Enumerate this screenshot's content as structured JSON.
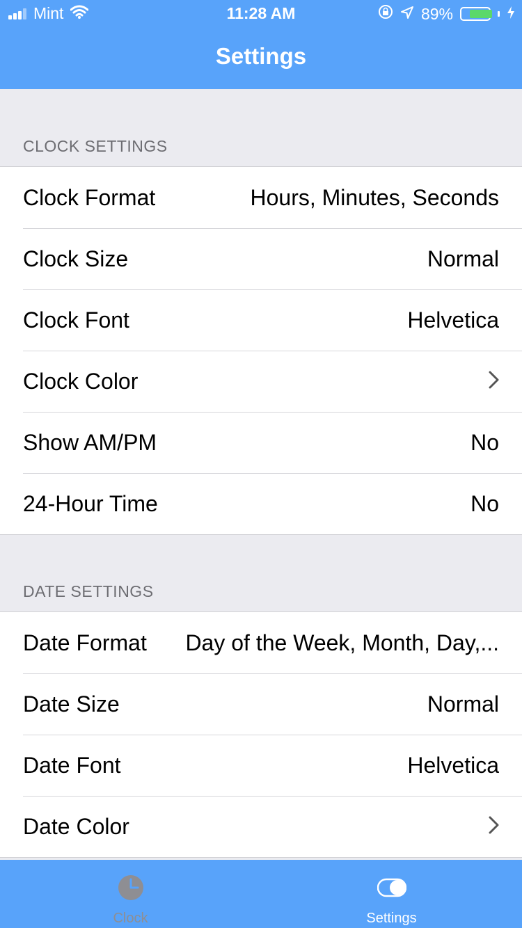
{
  "status_bar": {
    "carrier": "Mint",
    "time": "11:28 AM",
    "battery_percent": "89%",
    "battery_level": 0.89,
    "icons": [
      "signal-icon",
      "wifi-icon",
      "orientation-lock-icon",
      "location-icon",
      "battery-icon",
      "charging-icon"
    ]
  },
  "nav": {
    "title": "Settings"
  },
  "sections": {
    "clock": {
      "header": "CLOCK SETTINGS",
      "rows": [
        {
          "label": "Clock Format",
          "value": "Hours, Minutes, Seconds"
        },
        {
          "label": "Clock Size",
          "value": "Normal"
        },
        {
          "label": "Clock Font",
          "value": "Helvetica"
        },
        {
          "label": "Clock Color",
          "value": ""
        },
        {
          "label": "Show AM/PM",
          "value": "No"
        },
        {
          "label": "24-Hour Time",
          "value": "No"
        }
      ]
    },
    "date": {
      "header": "DATE SETTINGS",
      "rows": [
        {
          "label": "Date Format",
          "value": "Day of the Week, Month, Day,..."
        },
        {
          "label": "Date Size",
          "value": "Normal"
        },
        {
          "label": "Date Font",
          "value": "Helvetica"
        },
        {
          "label": "Date Color",
          "value": ""
        }
      ]
    }
  },
  "tabbar": {
    "tabs": [
      {
        "label": "Clock",
        "icon": "clock-icon",
        "selected": false
      },
      {
        "label": "Settings",
        "icon": "toggle-icon",
        "selected": true
      }
    ]
  },
  "colors": {
    "accent": "#58a3fa",
    "background": "#ebebf0",
    "tab_inactive": "#8e8e93",
    "battery_fill": "#5bd86a"
  }
}
